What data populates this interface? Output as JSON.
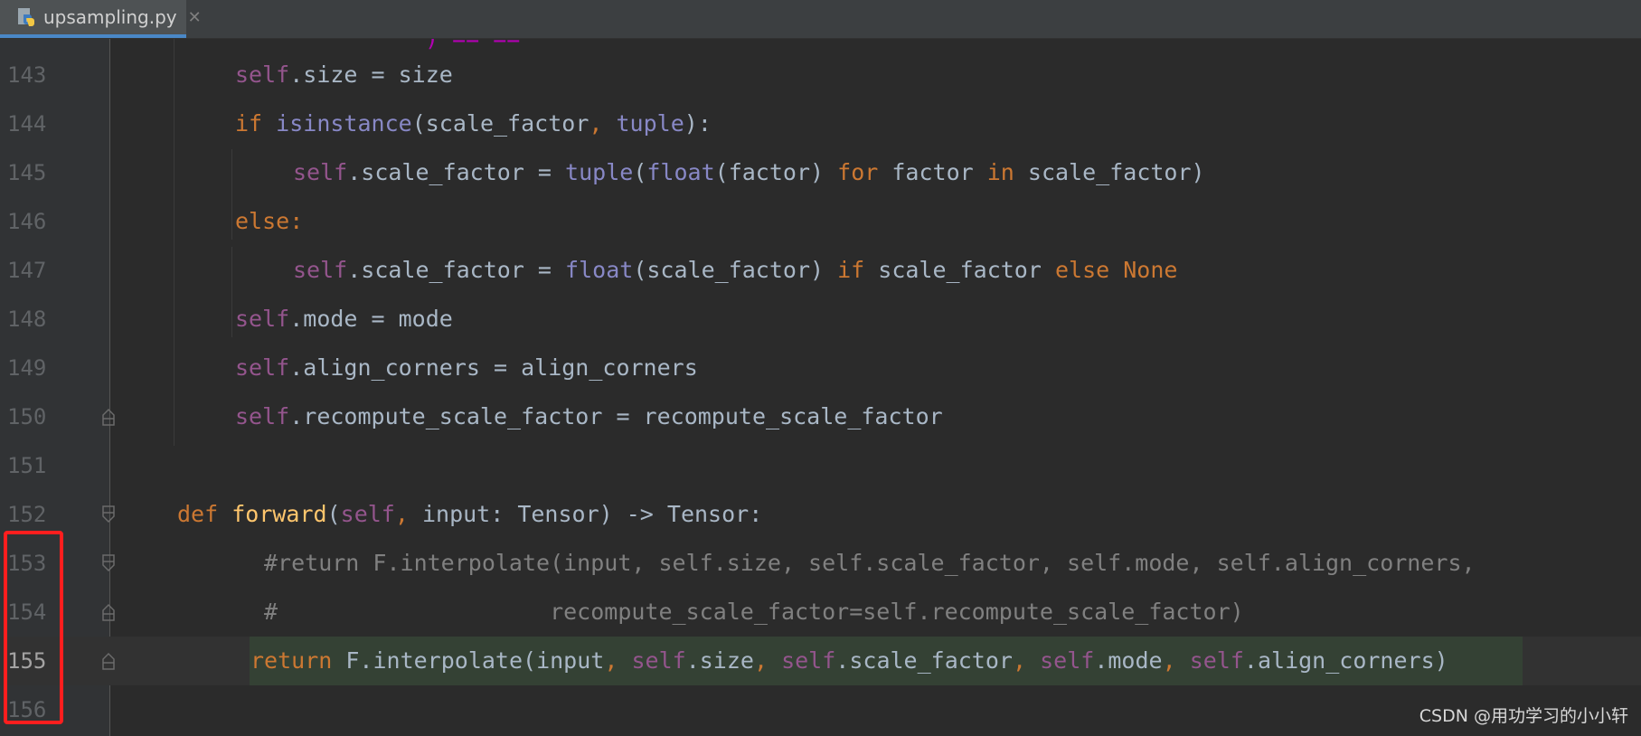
{
  "tab": {
    "title": "upsampling.py",
    "close": "✕",
    "icon": "python-file-icon"
  },
  "watermark": "CSDN @用功学习的小小轩",
  "colors": {
    "background": "#2b2b2b",
    "gutter": "#313335",
    "keyword": "#cc7832",
    "self": "#94558d",
    "builtin": "#8888c6",
    "function": "#ffc66d",
    "comment": "#808080",
    "highlight_box": "#ff1e1e"
  },
  "lines": [
    {
      "num": "143",
      "code": "self.size = size"
    },
    {
      "num": "144",
      "code": "if isinstance(scale_factor, tuple):"
    },
    {
      "num": "145",
      "code": "self.scale_factor = tuple(float(factor) for factor in scale_factor)"
    },
    {
      "num": "146",
      "code": "else:"
    },
    {
      "num": "147",
      "code": "self.scale_factor = float(scale_factor) if scale_factor else None"
    },
    {
      "num": "148",
      "code": "self.mode = mode"
    },
    {
      "num": "149",
      "code": "self.align_corners = align_corners"
    },
    {
      "num": "150",
      "code": "self.recompute_scale_factor = recompute_scale_factor"
    },
    {
      "num": "151",
      "code": ""
    },
    {
      "num": "152",
      "code": "def forward(self, input: Tensor) -> Tensor:"
    },
    {
      "num": "153",
      "code": "#return F.interpolate(input, self.size, self.scale_factor, self.mode, self.align_corners,"
    },
    {
      "num": "154",
      "code": "#                    recompute_scale_factor=self.recompute_scale_factor)"
    },
    {
      "num": "155",
      "code": "return F.interpolate(input, self.size, self.scale_factor, self.mode, self.align_corners)"
    },
    {
      "num": "156",
      "code": ""
    }
  ],
  "tokens": {
    "self": "self",
    "dot_size_eq": ".size = size",
    "if": "if",
    "isinstance": "isinstance",
    "lp": "(",
    "sf": "scale_factor",
    "comma": ",",
    "tuple": "tuple",
    "rp_colon": "):",
    "sf_eq": ".scale_factor = ",
    "float": "float",
    "factor": "factor",
    "rp": ")",
    "for": "for",
    "in": "in",
    "sf_close": "scale_factor)",
    "else_colon": "else:",
    "sfparen": "scale_factor)",
    "else": "else",
    "None": "None",
    "sfsp": "scale_factor",
    "mode_eq": ".mode = mode",
    "ac_eq": ".align_corners = align_corners",
    "rsf_eq": ".recompute_scale_factor = recompute_scale_factor",
    "def": "def",
    "forward": "forward",
    "sig_rest": " input: Tensor) -> Tensor:",
    "c153": "#return F.interpolate(input, self.size, self.scale_factor, self.mode, self.align_corners,",
    "c154": "#                    recompute_scale_factor=self.recompute_scale_factor)",
    "return": "return",
    "fi": " F.interpolate(input",
    "size": ".size",
    "sfac": ".scale_factor",
    "mode": ".mode",
    "ac": ".align_corners)",
    "top_partial": ") ==  =="
  }
}
